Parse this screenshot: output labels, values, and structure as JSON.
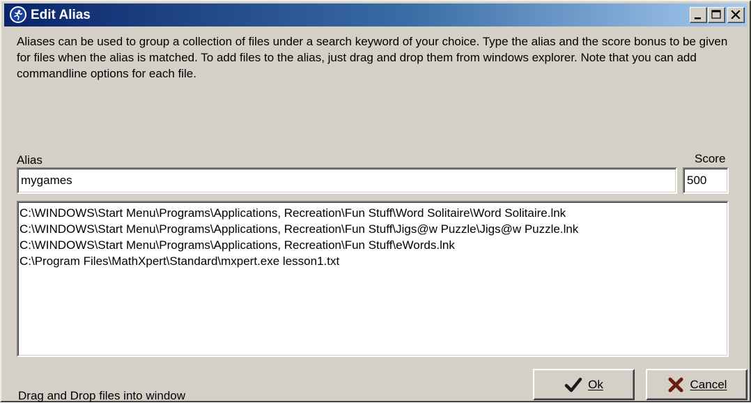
{
  "window": {
    "title": "Edit Alias"
  },
  "description": "Aliases can be used to group a collection of files under a search keyword of your choice.  Type the alias and the score bonus to be given for files when the alias is matched.  To add files to the alias, just drag and drop them from windows explorer.  Note that you can add commandline options for each file.",
  "alias": {
    "label": "Alias",
    "value": "mygames"
  },
  "score": {
    "label": "Score",
    "value": "500"
  },
  "files": [
    "C:\\WINDOWS\\Start Menu\\Programs\\Applications, Recreation\\Fun Stuff\\Word Solitaire\\Word Solitaire.lnk",
    "C:\\WINDOWS\\Start Menu\\Programs\\Applications, Recreation\\Fun Stuff\\Jigs@w Puzzle\\Jigs@w Puzzle.lnk",
    "C:\\WINDOWS\\Start Menu\\Programs\\Applications, Recreation\\Fun Stuff\\eWords.lnk",
    "C:\\Program Files\\MathXpert\\Standard\\mxpert.exe lesson1.txt"
  ],
  "status": "Drag and Drop files into window",
  "buttons": {
    "ok_label": "Ok",
    "cancel_label": "Cancel"
  },
  "colors": {
    "titlebar_start": "#0a246a",
    "titlebar_end": "#a6caf0",
    "face": "#d4d0c8",
    "ok_check": "#1a1a1a",
    "cancel_x": "#6b1a10"
  },
  "icons": {
    "app": "runner-icon",
    "minimize": "minimize-icon",
    "maximize": "maximize-icon",
    "close": "close-icon",
    "ok": "checkmark-icon",
    "cancel": "x-icon"
  }
}
